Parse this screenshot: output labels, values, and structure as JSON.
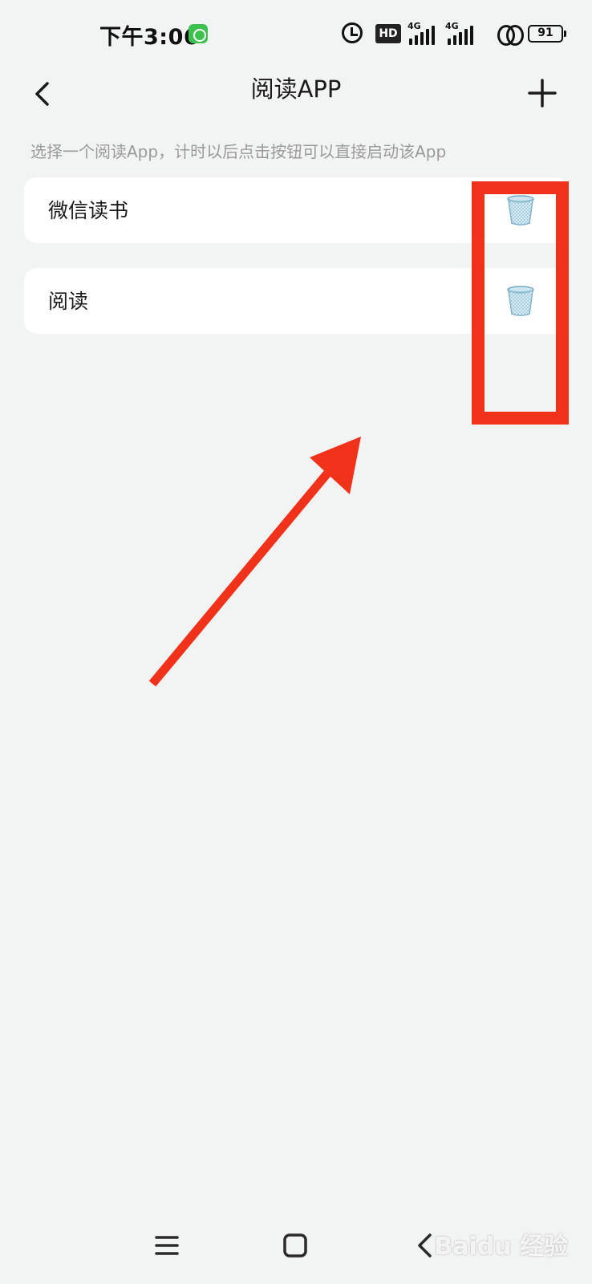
{
  "status_bar": {
    "time": "下午3:06",
    "app_icon": "green-app-icon",
    "hd_badge": "HD",
    "network_1": "4G",
    "network_2": "4G",
    "battery": "91",
    "icons": [
      "alarm-icon",
      "hd-icon",
      "signal-icon",
      "signal-icon",
      "link-icon",
      "battery-icon"
    ]
  },
  "header": {
    "title": "阅读APP",
    "back_icon": "chevron-left-icon",
    "add_icon": "plus-icon"
  },
  "description": "选择一个阅读App，计时以后点击按钮可以直接启动该App",
  "apps": [
    {
      "name": "微信读书",
      "delete_icon": "trash-icon"
    },
    {
      "name": "阅读",
      "delete_icon": "trash-icon"
    }
  ],
  "annotation": {
    "color": "#f0321a"
  },
  "nav_bar": {
    "icons": [
      "menu-icon",
      "home-icon",
      "back-icon"
    ]
  },
  "watermark": "Baidu 经验"
}
